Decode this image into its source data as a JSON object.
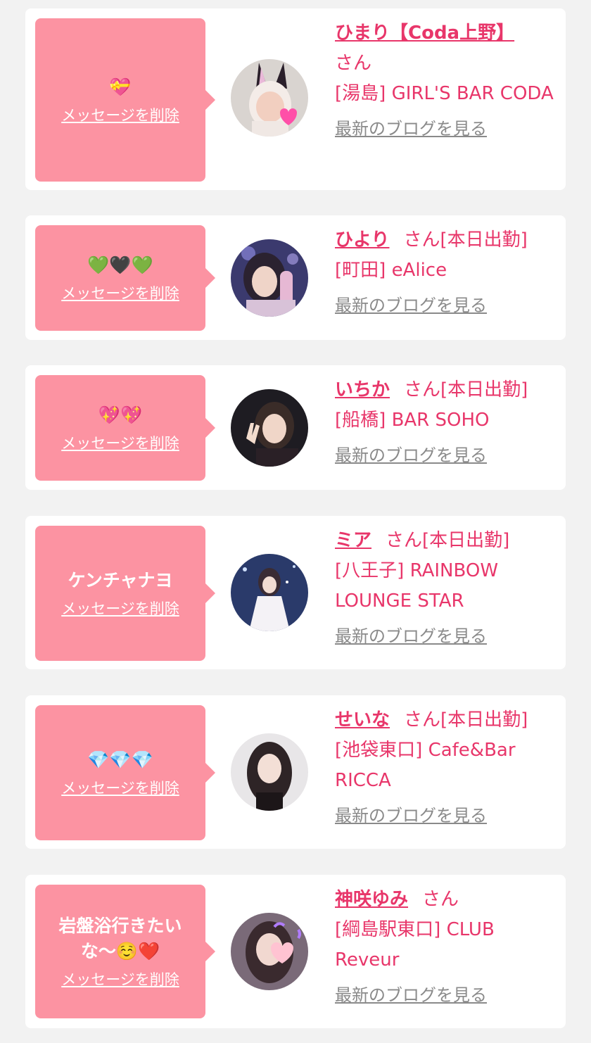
{
  "colors": {
    "background": "#f2f2f2",
    "card": "#ffffff",
    "bubble": "#fc93a2",
    "accent": "#e8366a",
    "link_gray": "#8a8a8a"
  },
  "cards": [
    {
      "message": "💝",
      "delete_label": "メッセージを削除",
      "name": "ひまり【Coda上野】",
      "honorific": "さん",
      "status": "",
      "area": "[湯島]",
      "shop": "GIRL'S BAR CODA",
      "blog_label": "最新のブログを見る",
      "avatar_icon": "bunny-ear-girl-photo"
    },
    {
      "message": "💚🖤💚",
      "delete_label": "メッセージを削除",
      "name": "ひより",
      "honorific": "さん",
      "status": "[本日出勤]",
      "area": "[町田]",
      "shop": "eAlice",
      "blog_label": "最新のブログを見る",
      "avatar_icon": "girl-photo"
    },
    {
      "message": "💖💖",
      "delete_label": "メッセージを削除",
      "name": "いちか",
      "honorific": "さん",
      "status": "[本日出勤]",
      "area": "[船橋]",
      "shop": "BAR SOHO",
      "blog_label": "最新のブログを見る",
      "avatar_icon": "girl-peace-sign-photo"
    },
    {
      "message": "ケンチャナヨ",
      "delete_label": "メッセージを削除",
      "name": "ミア",
      "honorific": "さん",
      "status": "[本日出勤]",
      "area": "[八王子]",
      "shop": "RAINBOW LOUNGE STAR",
      "blog_label": "最新のブログを見る",
      "avatar_icon": "girl-dress-photo"
    },
    {
      "message": "💎💎💎",
      "delete_label": "メッセージを削除",
      "name": "せいな",
      "honorific": "さん",
      "status": "[本日出勤]",
      "area": "[池袋東口]",
      "shop": "Cafe&Bar RICCA",
      "blog_label": "最新のブログを見る",
      "avatar_icon": "girl-photo"
    },
    {
      "message": "岩盤浴行きたいな〜☺️❤️",
      "delete_label": "メッセージを削除",
      "name": "神咲ゆみ",
      "honorific": "さん",
      "status": "",
      "area": "[綱島駅東口]",
      "shop": "CLUB Reveur",
      "blog_label": "最新のブログを見る",
      "avatar_icon": "girl-heart-sticker-photo"
    }
  ]
}
